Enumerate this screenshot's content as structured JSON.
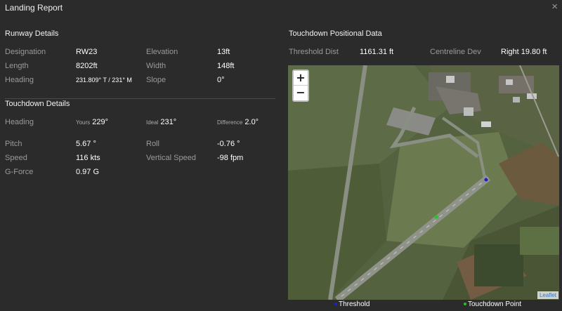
{
  "window": {
    "title": "Landing Report",
    "close_icon": "×"
  },
  "runway": {
    "heading": "Runway Details",
    "designation_label": "Designation",
    "designation": "RW23",
    "length_label": "Length",
    "length": "8202ft",
    "heading_label": "Heading",
    "heading_value": "231.809° T / 231° M",
    "elevation_label": "Elevation",
    "elevation": "13ft",
    "width_label": "Width",
    "width": "148ft",
    "slope_label": "Slope",
    "slope": "0°"
  },
  "touchdown": {
    "heading": "Touchdown Details",
    "heading_label": "Heading",
    "yours_label": "Yours",
    "yours": "229°",
    "ideal_label": "Ideal",
    "ideal": "231°",
    "difference_label": "Difference",
    "difference": "2.0°",
    "pitch_label": "Pitch",
    "pitch": "5.67 °",
    "roll_label": "Roll",
    "roll": "-0.76 °",
    "speed_label": "Speed",
    "speed": "116 kts",
    "vs_label": "Vertical Speed",
    "vs": "-98 fpm",
    "gforce_label": "G-Force",
    "gforce": "0.97 G"
  },
  "positional": {
    "heading": "Touchdown Positional Data",
    "threshold_label": "Threshold Dist",
    "threshold": "1161.31 ft",
    "centreline_label": "Centreline Dev",
    "centreline": "Right 19.80 ft"
  },
  "map": {
    "zoom_in": "+",
    "zoom_out": "−",
    "attribution": "Leaflet",
    "legend_threshold": "Threshold",
    "legend_touchdown": "Touchdown Point",
    "threshold_color": "#1e1ecf",
    "touchdown_color": "#27c427"
  }
}
